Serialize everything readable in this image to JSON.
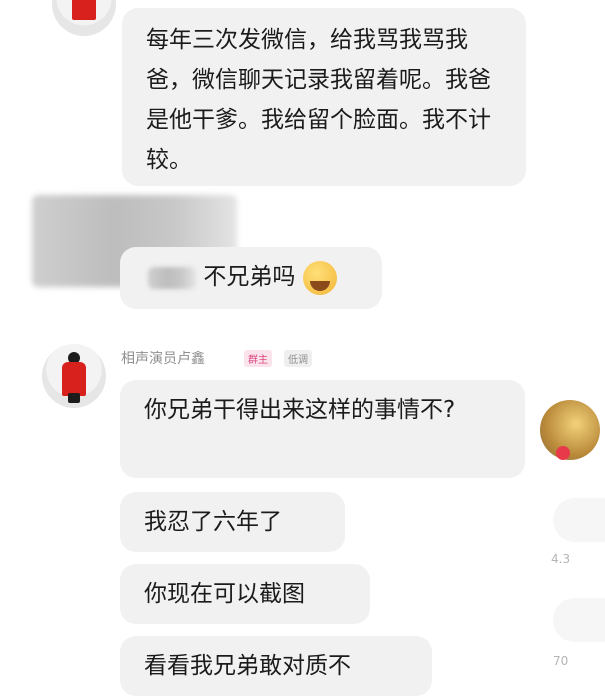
{
  "messages": {
    "msg1": "每年三次发微信，给我骂我骂我爸，微信聊天记录我留着呢。我爸是他干爹。我给留个脸面。我不计较。",
    "msg2_visible": "不兄弟吗",
    "sender_name": "相声演员卢鑫",
    "sender_badge_group": "群主",
    "sender_badge_status": "低调",
    "msg3": "你兄弟干得出来这样的事情不?",
    "msg4": "我忍了六年了",
    "msg5": "你现在可以截图",
    "msg6": "看看我兄弟敢对质不"
  },
  "side_snippets": {
    "count1": "4.3",
    "count2": "70"
  },
  "icons": {
    "avatar": "avatar-icon",
    "crying_emoji": "crying-emoji-icon"
  },
  "colors": {
    "bubble": "#f1f1f1",
    "badge_group": "#e0608f",
    "avatar_robe": "#d8201d"
  }
}
